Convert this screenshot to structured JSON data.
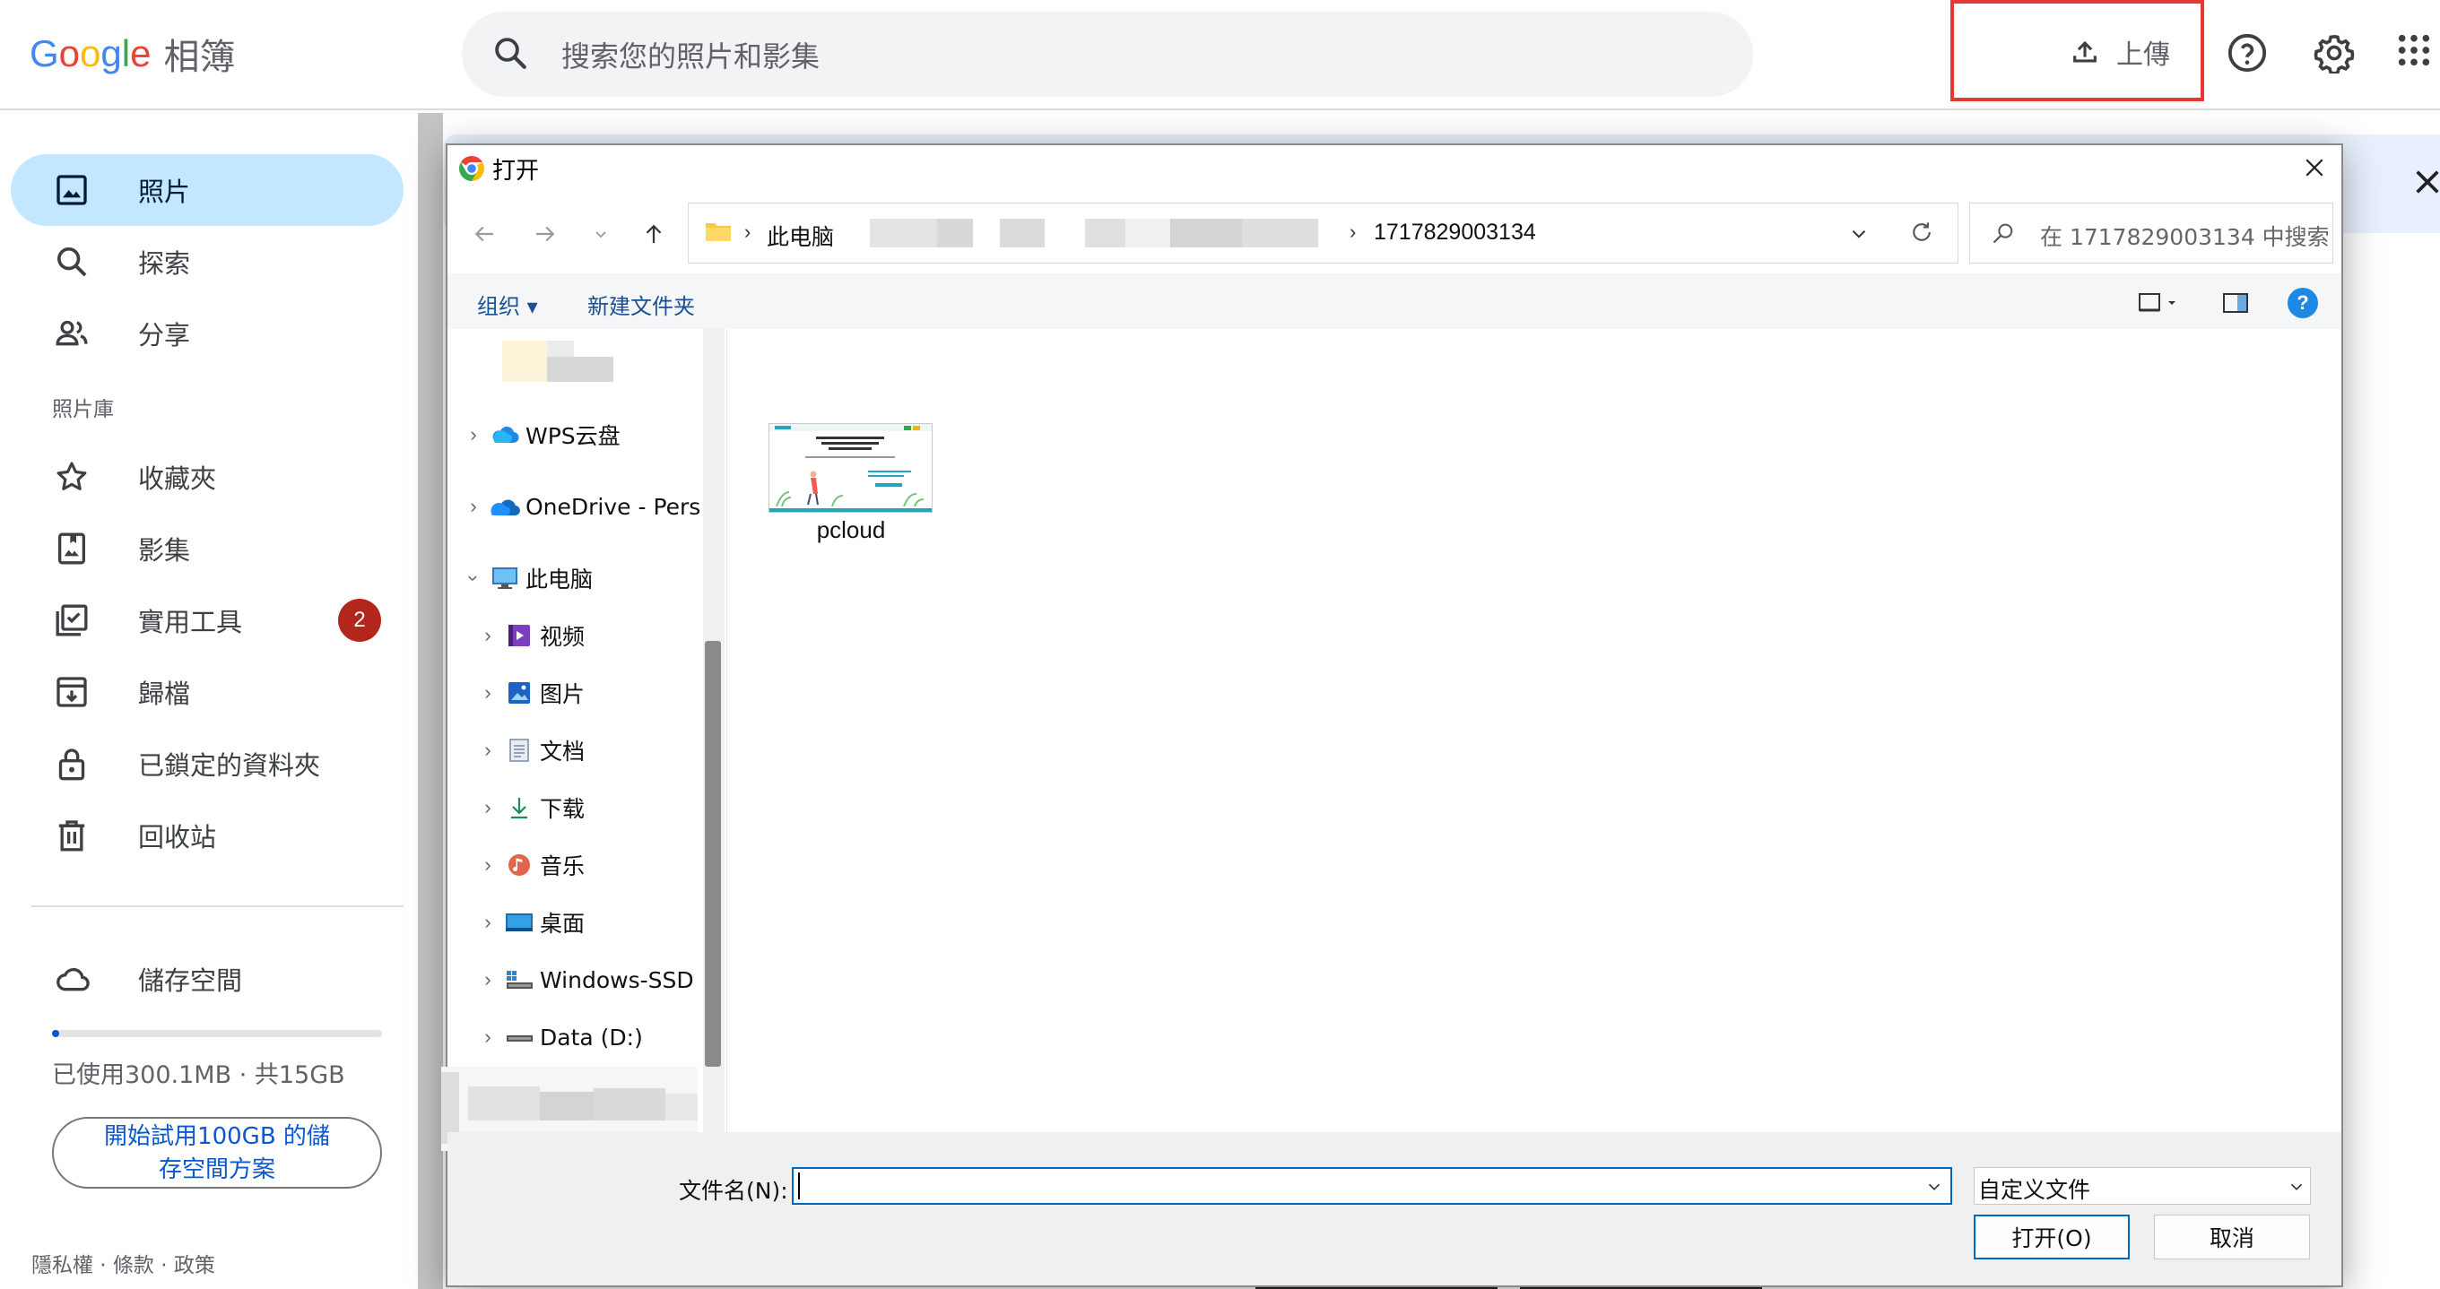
{
  "app": {
    "logo_word": "Google",
    "product": "相簿",
    "search_placeholder": "搜索您的照片和影集",
    "upload_label": "上傳"
  },
  "sidebar": {
    "items": [
      {
        "label": "照片",
        "icon": "photo-icon",
        "active": true
      },
      {
        "label": "探索",
        "icon": "search-icon"
      },
      {
        "label": "分享",
        "icon": "people-icon"
      }
    ],
    "section_title": "照片庫",
    "library_items": [
      {
        "label": "收藏夾",
        "icon": "star-icon"
      },
      {
        "label": "影集",
        "icon": "album-icon"
      },
      {
        "label": "實用工具",
        "icon": "utilities-icon",
        "badge": "2"
      },
      {
        "label": "歸檔",
        "icon": "archive-icon"
      },
      {
        "label": "已鎖定的資料夾",
        "icon": "lock-icon"
      },
      {
        "label": "回收站",
        "icon": "trash-icon"
      }
    ],
    "storage": {
      "label": "儲存空間",
      "usage": "已使用300.1MB · 共15GB",
      "used_fraction": 0.02,
      "trial_line1": "開始試用100GB 的儲",
      "trial_line2": "存空間方案"
    },
    "footer": "隱私權 · 條款 · 政策"
  },
  "dialog": {
    "title": "打开",
    "address": {
      "root": "此电脑",
      "folder": "1717829003134"
    },
    "search_placeholder": "在 1717829003134 中搜索",
    "commands": {
      "organize": "组织 ▾",
      "new_folder": "新建文件夹"
    },
    "tree": [
      {
        "label": "WPS云盘",
        "icon": "cloud-icon",
        "level": 0,
        "expanded": false
      },
      {
        "label": "OneDrive - Pers",
        "icon": "onedrive-icon",
        "level": 0,
        "expanded": false
      },
      {
        "label": "此电脑",
        "icon": "computer-icon",
        "level": 0,
        "expanded": true
      },
      {
        "label": "视频",
        "icon": "video-icon",
        "level": 1,
        "expanded": false
      },
      {
        "label": "图片",
        "icon": "pictures-icon",
        "level": 1,
        "expanded": false
      },
      {
        "label": "文档",
        "icon": "documents-icon",
        "level": 1,
        "expanded": false
      },
      {
        "label": "下载",
        "icon": "download-icon",
        "level": 1,
        "expanded": false
      },
      {
        "label": "音乐",
        "icon": "music-icon",
        "level": 1,
        "expanded": false
      },
      {
        "label": "桌面",
        "icon": "desktop-icon",
        "level": 1,
        "expanded": false
      },
      {
        "label": "Windows-SSD",
        "icon": "drive-c-icon",
        "level": 1,
        "expanded": false
      },
      {
        "label": "Data (D:)",
        "icon": "drive-d-icon",
        "level": 1,
        "expanded": false
      }
    ],
    "files": [
      {
        "name": "pcloud"
      }
    ],
    "filename_label": "文件名(N):",
    "filename_value": "",
    "filetype_value": "自定义文件",
    "open_button": "打开(O)",
    "cancel_button": "取消"
  },
  "colors": {
    "accent": "#0b57d0",
    "active_nav": "#c2e7ff",
    "badge": "#b3261e",
    "highlight_box": "#e53935",
    "dialog_focus": "#0067c0"
  }
}
